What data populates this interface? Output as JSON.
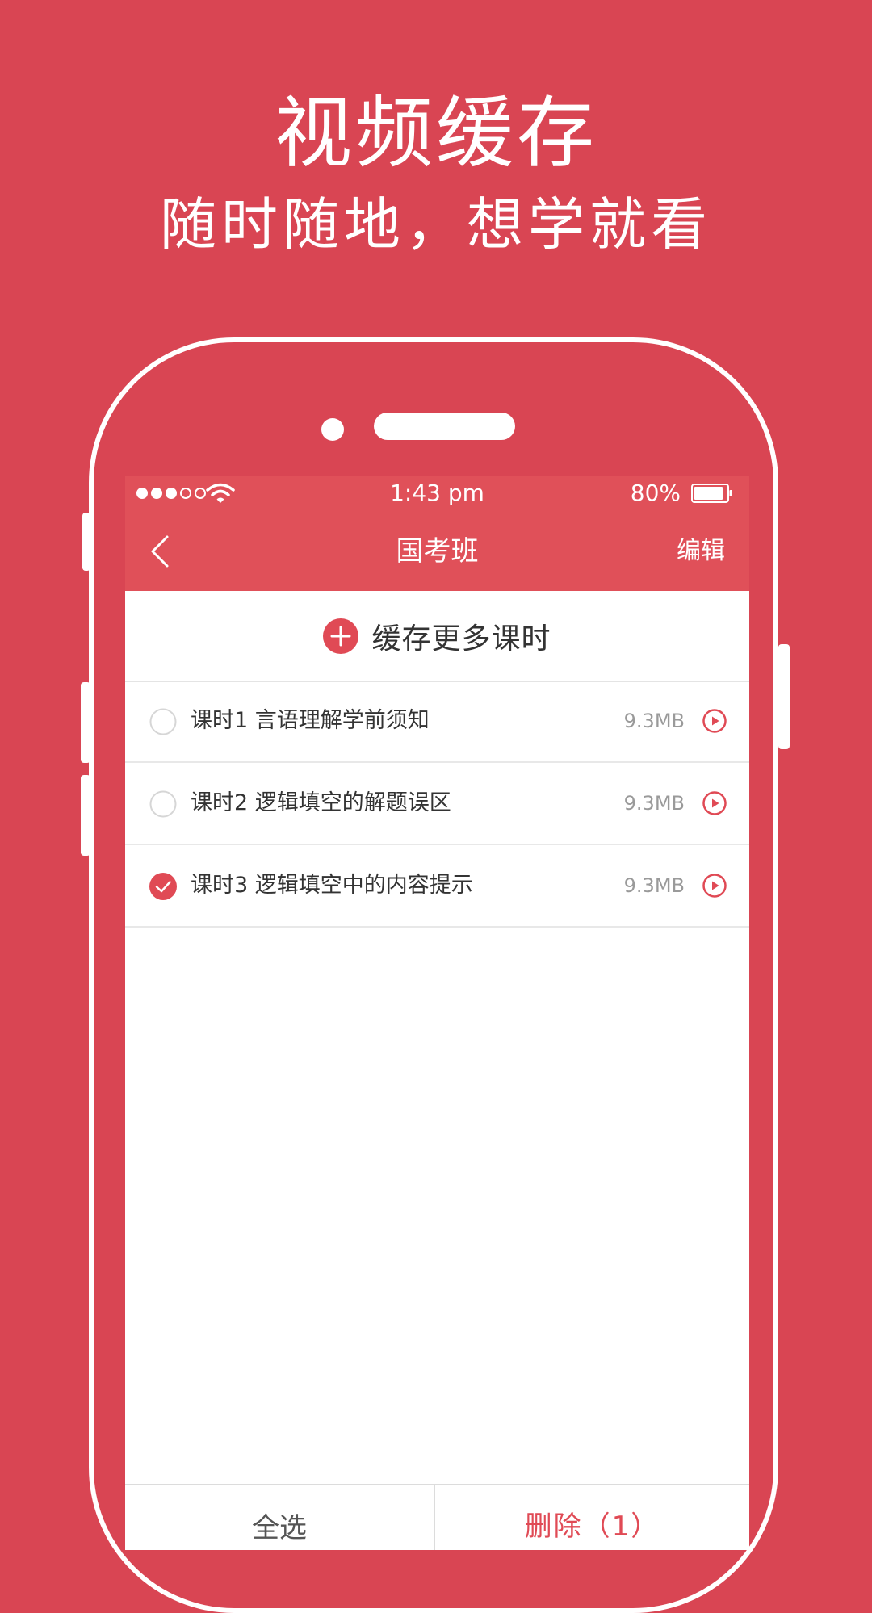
{
  "promo": {
    "title": "视频缓存",
    "subtitle": "随时随地，想学就看"
  },
  "status_bar": {
    "time": "1:43 pm",
    "battery": "80%",
    "signal_bars_filled": 3,
    "signal_bars_total": 5
  },
  "nav": {
    "back_icon": "chevron-left-icon",
    "title": "国考班",
    "edit_label": "编辑"
  },
  "cache_more": {
    "icon": "plus-circle-icon",
    "label": "缓存更多课时"
  },
  "lessons": [
    {
      "title": "课时1  言语理解学前须知",
      "size": "9.3MB",
      "selected": false
    },
    {
      "title": "课时2  逻辑填空的解题误区",
      "size": "9.3MB",
      "selected": false
    },
    {
      "title": "课时3  逻辑填空中的内容提示",
      "size": "9.3MB",
      "selected": true
    }
  ],
  "bottom_bar": {
    "select_all_label": "全选",
    "delete_label": "删除（1）"
  },
  "colors": {
    "background": "#d94553",
    "accent": "#e05059",
    "checked": "#e04a55"
  }
}
